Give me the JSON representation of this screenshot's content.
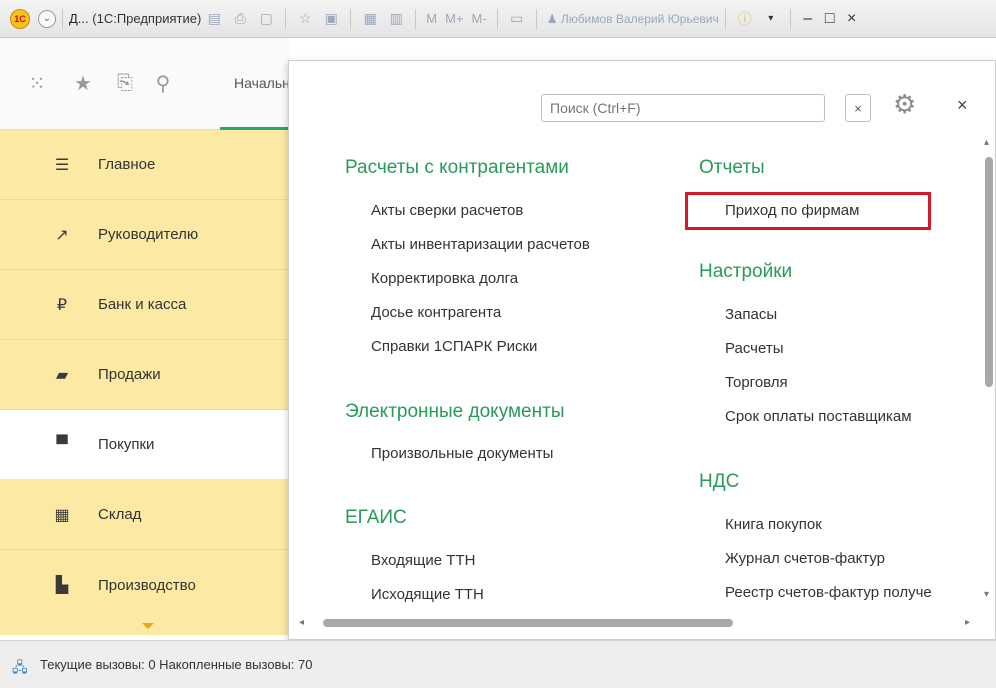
{
  "titlebar": {
    "title_short": "Д...",
    "title_app": "(1С:Предприятие)",
    "buttons": [
      "M",
      "M+",
      "M-"
    ],
    "user": "Любимов Валерий Юрьевич"
  },
  "topnav": {
    "start_tab": "Начальная страница"
  },
  "sidebar": {
    "items": [
      {
        "label": "Главное",
        "icon": "menu-lines-icon"
      },
      {
        "label": "Руководителю",
        "icon": "trend-icon"
      },
      {
        "label": "Банк и касса",
        "icon": "ruble-icon"
      },
      {
        "label": "Продажи",
        "icon": "bag-icon"
      },
      {
        "label": "Покупки",
        "icon": "cart-icon"
      },
      {
        "label": "Склад",
        "icon": "warehouse-icon"
      },
      {
        "label": "Производство",
        "icon": "factory-icon"
      }
    ],
    "active": "Покупки"
  },
  "panel": {
    "search_placeholder": "Поиск (Ctrl+F)",
    "col1": {
      "group1": "Расчеты с контрагентами",
      "group1_items": [
        "Акты сверки расчетов",
        "Акты инвентаризации расчетов",
        "Корректировка долга",
        "Досье контрагента",
        "Справки 1СПАРК Риски"
      ],
      "group2": "Электронные документы",
      "group2_items": [
        "Произвольные документы"
      ],
      "group3": "ЕГАИС",
      "group3_items": [
        "Входящие ТТН",
        "Исходящие ТТН"
      ]
    },
    "col2": {
      "group1": "Отчеты",
      "group1_items": [
        "Приход по фирмам"
      ],
      "group2": "Настройки",
      "group2_items": [
        "Запасы",
        "Расчеты",
        "Торговля",
        "Срок оплаты поставщикам"
      ],
      "group3": "НДС",
      "group3_items": [
        "Книга покупок",
        "Журнал счетов-фактур",
        "Реестр счетов-фактур получе"
      ]
    }
  },
  "status": {
    "text": "Текущие вызовы: 0   Накопленные вызовы: 70"
  }
}
